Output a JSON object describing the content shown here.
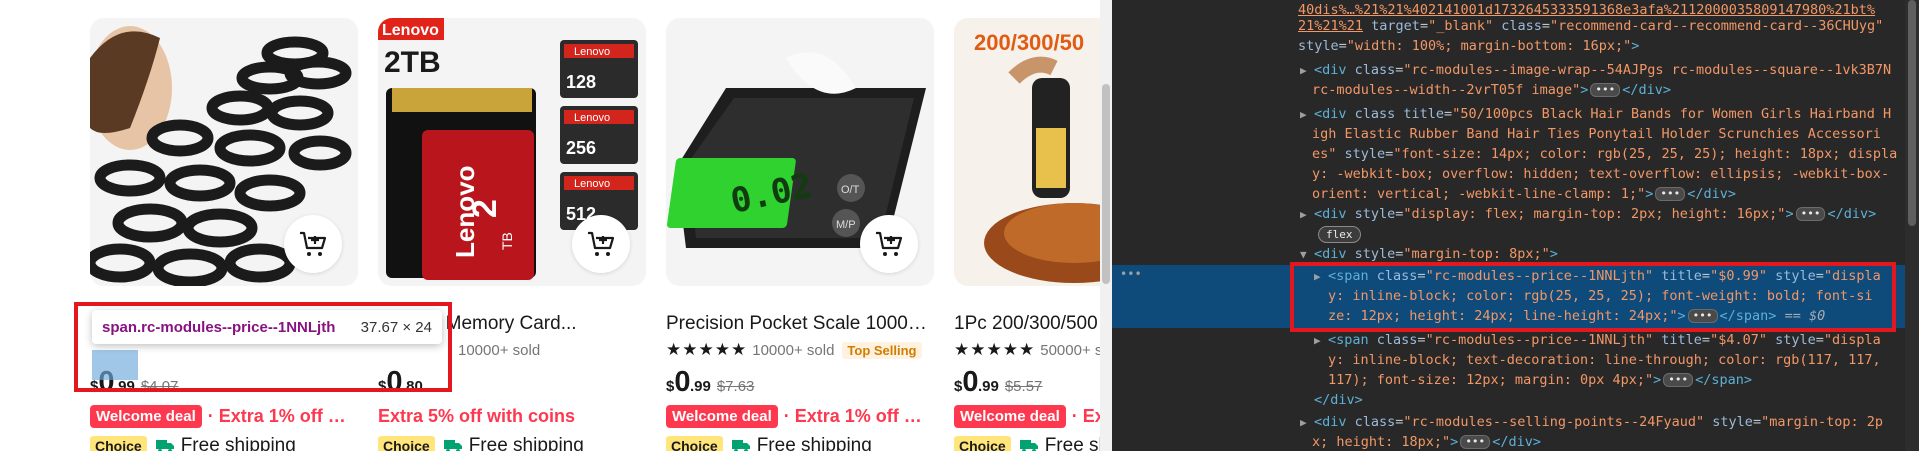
{
  "products": [
    {
      "title": "50/100pcs Black Hair Bands for Women Girls Hairband High Elastic Rubber Band Hair Ties Ponytail Holder Scrunchies Accessories",
      "title_visible": "",
      "sold": "",
      "price_currency": "$",
      "price_int": "0",
      "price_dec": ".99",
      "price_old": "$4.07",
      "deal_pill": "Welcome deal",
      "deal_text": "· Extra 1% off wi...",
      "choice": "Choice",
      "shipping": "Free shipping",
      "image": "black-hair-ties"
    },
    {
      "title": "Lenovo Memory Card...",
      "sold": "10000+ sold",
      "price_currency": "$",
      "price_int": "0",
      "price_dec": ".80",
      "price_old": "",
      "deal_pill": "",
      "deal_text": "Extra 5% off with coins",
      "choice": "Choice",
      "shipping": "Free shipping",
      "image": "lenovo-sd-cards",
      "image_labels": {
        "banner": "Lenovo",
        "capacity_big": "2TB",
        "card_brand": "Lenovo",
        "card_size": "2",
        "card_unit": "TB",
        "small_cards": [
          "128",
          "256",
          "512"
        ],
        "card_mini_brand": "Lenovo"
      }
    },
    {
      "title": "Precision Pocket Scale 1000g X...",
      "sold": "10000+ sold",
      "badge": "Top Selling",
      "price_currency": "$",
      "price_int": "0",
      "price_dec": ".99",
      "price_old": "$7.63",
      "deal_pill": "Welcome deal",
      "deal_text": "· Extra 1% off wi...",
      "choice": "Choice",
      "shipping": "Free shipping",
      "image": "pocket-scale",
      "image_labels": {
        "display": "0.02",
        "btn1": "O/T",
        "btn2": "M/P"
      }
    },
    {
      "title": "1Pc 200/300/500",
      "sold": "50000+ s",
      "price_currency": "$",
      "price_int": "0",
      "price_dec": ".99",
      "price_old": "$5.57",
      "deal_pill": "Welcome deal",
      "deal_text": "· Ext",
      "choice": "Choice",
      "shipping": "Free shi",
      "image": "oil-sprayer",
      "image_labels": {
        "banner": "200/300/50"
      }
    }
  ],
  "inspector_tooltip": {
    "selector": "span.rc-modules--price--1NNLjth",
    "dims": "37.67 × 24"
  },
  "devtools": {
    "lines": [
      {
        "kind": "raw",
        "text_link1": "40dis%…%21%21%402141001d1732645333591368e3afa%2112000035809147980%21bt%",
        "indent": 0
      },
      {
        "kind": "raw",
        "text_link2": "21%21%21",
        "indent": 0
      },
      {
        "target_attr": "target",
        "target_val": "\"_blank\"",
        "class_attr": "class",
        "class_val": "\"recommend-card--recommend-card--36CHUyg\""
      },
      {
        "style_attr": "style",
        "style_val": "\"width: 100%; margin-bottom: 16px;\""
      },
      {
        "tag": "div",
        "class_val": "\"rc-modules--image-wrap--54AJPgs rc-modules--square--1vk3B7N",
        "class_val2": "rc-modules--width--2vrT05f image\""
      },
      {
        "tag": "div",
        "title_val": "\"50/100pcs Black Hair Bands for Women Girls Hairband H",
        "title_val2": "igh Elastic Rubber Band Hair Ties Ponytail Holder Scrunchies Accessori",
        "title_val3": "es\"",
        "style_val": "\"font-size: 14px; color: rgb(25, 25, 25); height: 18px; displa",
        "style_val2": "y: -webkit-box; overflow: hidden; text-overflow: ellipsis; -webkit-box-",
        "style_val3": "orient: vertical; -webkit-line-clamp: 1;\""
      },
      {
        "tag": "div",
        "style_val": "\"display: flex; margin-top: 2px; height: 16px;\""
      },
      {
        "badge": "flex"
      },
      {
        "tag": "div",
        "style_val": "\"margin-top: 8px;\""
      },
      {
        "selected": true,
        "tag": "span",
        "class_val": "\"rc-modules--price--1NNLjth\"",
        "title_val": "\"$0.99\"",
        "style_val": "\"displa",
        "style_val2": "y: inline-block; color: rgb(25, 25, 25); font-weight: bold; font-si",
        "style_val3": "ze: 12px; height: 24px; line-height: 24px;\"",
        "eq": "== $0"
      },
      {
        "tag": "span",
        "class_val": "\"rc-modules--price--1NNLjth\"",
        "title_val": "\"$4.07\"",
        "style_val": "\"displa",
        "style_val2": "y: inline-block; text-decoration: line-through; color: rgb(117, 117,",
        "style_val3": "117); font-size: 12px; margin: 0px 4px;\""
      },
      {
        "close": "</div>"
      },
      {
        "tag": "div",
        "class_val": "\"rc-modules--selling-points--24Fyaud\"",
        "style_val": "\"margin-top: 2p",
        "style_val2": "x; height: 18px;\""
      }
    ]
  },
  "colors": {
    "deal_red": "#fd384f",
    "choice_yellow": "#ffe57a",
    "ship_green": "#00a271",
    "devtools_bg": "#282828",
    "selected_row": "#0e4a7a",
    "highlight_red": "#e3171e"
  }
}
